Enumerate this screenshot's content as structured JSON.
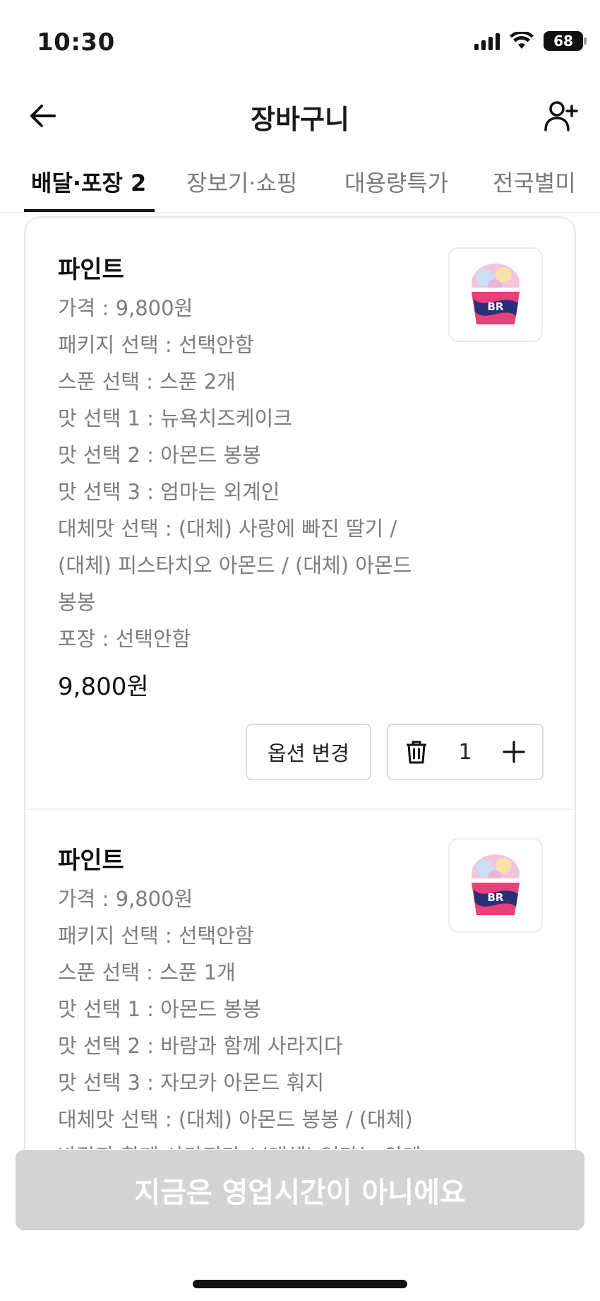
{
  "status_bar": {
    "time": "10:30",
    "battery": "68"
  },
  "header": {
    "title": "장바구니"
  },
  "tabs": [
    {
      "label": "배달·포장 2",
      "active": true
    },
    {
      "label": "장보기·쇼핑",
      "active": false
    },
    {
      "label": "대용량특가",
      "active": false
    },
    {
      "label": "전국별미",
      "active": false
    }
  ],
  "cart_items": [
    {
      "name": "파인트",
      "options": [
        "가격 : 9,800원",
        "패키지 선택 : 선택안함",
        "스푼 선택 : 스푼 2개",
        "맛 선택 1 : 뉴욕치즈케이크",
        "맛 선택 2 : 아몬드 봉봉",
        "맛 선택 3 : 엄마는 외계인",
        "대체맛 선택 : (대체) 사랑에 빠진 딸기 / (대체) 피스타치오 아몬드 / (대체) 아몬드 봉봉",
        "포장 : 선택안함"
      ],
      "price": "9,800원",
      "option_change_label": "옵션 변경",
      "quantity": "1"
    },
    {
      "name": "파인트",
      "options": [
        "가격 : 9,800원",
        "패키지 선택 : 선택안함",
        "스푼 선택 : 스푼 1개",
        "맛 선택 1 : 아몬드 봉봉",
        "맛 선택 2 : 바람과 함께 사라지다",
        "맛 선택 3 : 자모카 아몬드 훠지",
        "대체맛 선택 : (대체) 아몬드 봉봉 / (대체) 바람과 함께 사라지다 / (대체) 엄마는 외계"
      ]
    }
  ],
  "bottom_button": {
    "label": "지금은 영업시간이 아니에요"
  }
}
